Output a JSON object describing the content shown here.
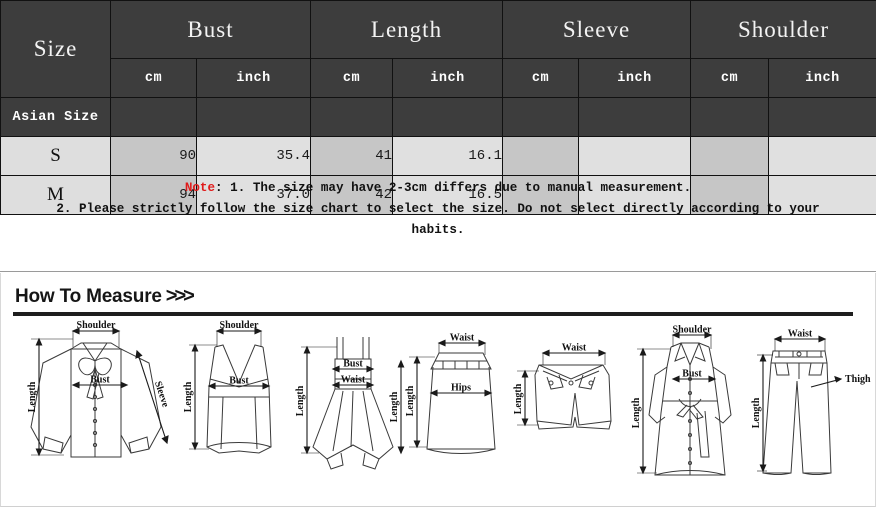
{
  "size_table": {
    "group_headers": [
      "Size",
      "Bust",
      "Length",
      "Sleeve",
      "Shoulder"
    ],
    "sub_header_label": "Asian Size",
    "unit_headers": [
      "cm",
      "inch",
      "cm",
      "inch",
      "cm",
      "inch",
      "cm",
      "inch"
    ],
    "rows": [
      {
        "size": "S",
        "bust_cm": "90",
        "bust_inch": "35.4",
        "length_cm": "41",
        "length_inch": "16.1",
        "sleeve_cm": "",
        "sleeve_inch": "",
        "shoulder_cm": "",
        "shoulder_inch": ""
      },
      {
        "size": "M",
        "bust_cm": "94",
        "bust_inch": "37.0",
        "length_cm": "42",
        "length_inch": "16.5",
        "sleeve_cm": "",
        "sleeve_inch": "",
        "shoulder_cm": "",
        "shoulder_inch": ""
      }
    ],
    "colors": {
      "header_bg": "#3d3d3d",
      "header_text": "#ffffff",
      "cm_cell_bg": "#c6c6c6",
      "inch_cell_bg": "#e0e0e0",
      "size_cell_bg": "#dedede",
      "grid_line": "#111111"
    }
  },
  "note": {
    "label": "Note",
    "label_color": "#e01b1b",
    "line1_rest": ": 1. The size may have 2-3cm differs due to manual measurement.",
    "line2": "2. Please strictly follow the size chart to select the size. Do not select directly according to your",
    "line3": "habits."
  },
  "how_to_measure": {
    "title": "How To Measure",
    "chevrons": ">>>",
    "diagrams": [
      {
        "garment": "bow-blouse",
        "labels": [
          "Shoulder",
          "Bust",
          "Length",
          "Sleeve"
        ]
      },
      {
        "garment": "camisole-top",
        "labels": [
          "Shoulder",
          "Bust",
          "Length"
        ]
      },
      {
        "garment": "strap-dress",
        "labels": [
          "Bust",
          "Waist",
          "Length"
        ]
      },
      {
        "garment": "skirt",
        "labels": [
          "Waist",
          "Hips",
          "Length"
        ]
      },
      {
        "garment": "shorts",
        "labels": [
          "Waist",
          "Length"
        ]
      },
      {
        "garment": "trench-coat",
        "labels": [
          "Shoulder",
          "Bust",
          "Length"
        ]
      },
      {
        "garment": "pants",
        "labels": [
          "Waist",
          "Thigh",
          "Length"
        ]
      }
    ]
  }
}
